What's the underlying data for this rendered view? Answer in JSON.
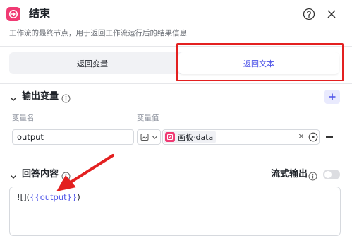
{
  "header": {
    "title": "结束",
    "description": "工作流的最终节点，用于返回工作流运行后的结果信息"
  },
  "tabs": [
    {
      "label": "返回变量",
      "active": false
    },
    {
      "label": "返回文本",
      "active": true
    }
  ],
  "output_section": {
    "title": "输出变量",
    "col_name_label": "变量名",
    "col_value_label": "变量值",
    "row": {
      "name": "output",
      "ref_source": "画板",
      "ref_separator": " · ",
      "ref_variable": "data"
    }
  },
  "answer_section": {
    "title": "回答内容",
    "stream_label": "流式输出",
    "stream_enabled": false,
    "content_prefix": "![](",
    "content_variable": "{{output}}",
    "content_suffix": ")"
  },
  "colors": {
    "accent": "#4d53e8",
    "node_icon": "#f03a73",
    "annotation": "#e32020"
  }
}
